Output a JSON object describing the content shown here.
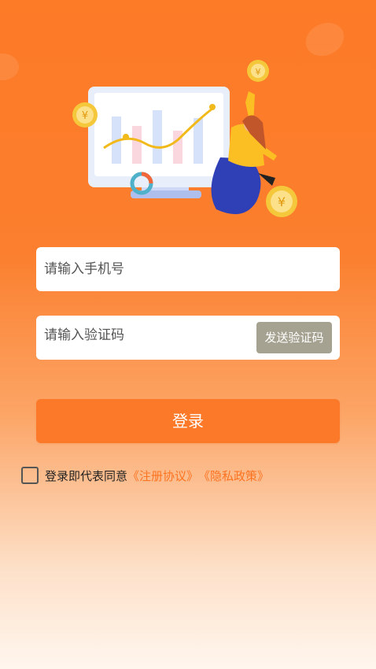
{
  "form": {
    "phone_placeholder": "请输入手机号",
    "code_placeholder": "请输入验证码",
    "send_code_label": "发送验证码",
    "login_label": "登录"
  },
  "agreement": {
    "prefix": "登录即代表同意",
    "terms_link": "《注册协议》",
    "privacy_link": "《隐私政策》"
  },
  "hero": {
    "coin_symbol": "¥"
  },
  "colors": {
    "brand_orange": "#fc7929",
    "send_button_bg": "#a6a291",
    "link_orange": "#fc7320"
  }
}
